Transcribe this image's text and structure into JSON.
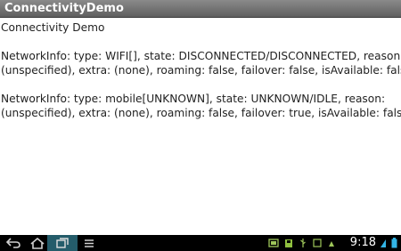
{
  "app": {
    "title": "ConnectivityDemo"
  },
  "content": {
    "heading": "Connectivity Demo",
    "wifi_line1": "NetworkInfo: type: WIFI[], state: DISCONNECTED/DISCONNECTED, reason:",
    "wifi_line2": "(unspecified), extra: (none), roaming: false, failover: false, isAvailable: false",
    "mobile_line1": "NetworkInfo: type: mobile[UNKNOWN], state: UNKNOWN/IDLE, reason:",
    "mobile_line2": "(unspecified), extra: (none), roaming: false, failover: true, isAvailable: false"
  },
  "navbar": {
    "buttons": [
      "back-icon",
      "home-icon",
      "recent-apps-icon",
      "menu-icon"
    ],
    "status_icons": [
      "screenshot-icon",
      "storage-icon",
      "usb-icon",
      "debug-icon",
      "cast-icon",
      "wifi-icon"
    ],
    "time": "9:18",
    "accent": "#33b5e5",
    "active_bg": "#245c6a"
  }
}
